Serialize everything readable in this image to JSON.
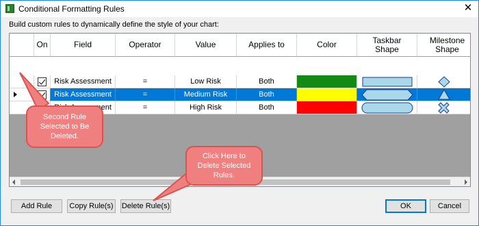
{
  "window": {
    "title": "Conditional Formatting Rules",
    "close_glyph": "✕"
  },
  "instruction": "Build custom rules to dynamically define the style of your chart:",
  "grid": {
    "columns": {
      "on": "On",
      "field": "Field",
      "operator": "Operator",
      "value": "Value",
      "applies_to": "Applies to",
      "color": "Color",
      "taskbar_shape": "Taskbar Shape",
      "milestone_shape": "Milestone Shape"
    },
    "rows": [
      {
        "on": true,
        "field": "Risk Assessment",
        "operator": "=",
        "value": "Low Risk",
        "applies_to": "Both",
        "color": "#138a14",
        "taskbar_shape": "rectangle",
        "milestone_shape": "diamond",
        "selected": false
      },
      {
        "on": true,
        "field": "Risk Assessment",
        "operator": "=",
        "value": "Medium Risk",
        "applies_to": "Both",
        "color": "#ffff00",
        "taskbar_shape": "hexagon",
        "milestone_shape": "triangle",
        "selected": true
      },
      {
        "on": true,
        "field": "Risk Assessment",
        "operator": "=",
        "value": "High Risk",
        "applies_to": "Both",
        "color": "#ff0000",
        "taskbar_shape": "rounded",
        "milestone_shape": "x-cross",
        "selected": false
      }
    ]
  },
  "buttons": {
    "add_rule": "Add Rule",
    "copy_rules": "Copy Rule(s)",
    "delete_rules": "Delete Rule(s)",
    "ok": "OK",
    "cancel": "Cancel"
  },
  "callouts": {
    "second_rule": "Second Rule Selected to Be Deleted.",
    "delete_hint": "Click Here to Delete Selected Rules."
  },
  "colors": {
    "accent": "#0078d7",
    "callout_fill": "#f08080",
    "callout_border": "#d9534f",
    "shape_fill": "#a8d8ea",
    "shape_stroke": "#1e3a8a"
  }
}
